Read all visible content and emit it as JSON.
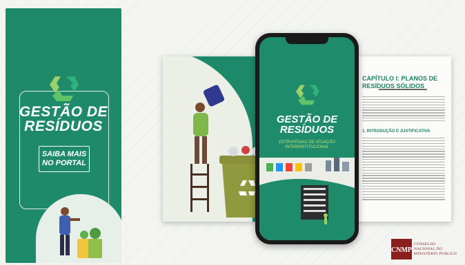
{
  "left_banner": {
    "title_line1": "GESTÃO DE",
    "title_line2": "RESÍDUOS",
    "cta_line1": "SAIBA MAIS",
    "cta_line2": "NO PORTAL"
  },
  "phone_cover": {
    "title_line1": "GESTÃO DE",
    "title_line2": "RESÍDUOS",
    "subtitle_line1": "ESTRATÉGIAS DE ATUAÇÃO",
    "subtitle_line2": "INTERINSTITUCIONAL"
  },
  "document": {
    "chapter_line1": "CAPÍTULO I: PLANOS DE",
    "chapter_line2": "RESÍDUOS SÓLIDOS",
    "section": "1. INTRODUÇÃO E JUSTIFICATIVA"
  },
  "cnmp_logo": {
    "monogram": "CNMP",
    "line1": "CONSELHO",
    "line2": "NACIONAL DO",
    "line3": "MINISTÉRIO PÚBLICO"
  },
  "colors": {
    "brand_green": "#1f8a6a",
    "accent_lime": "#c7e27a",
    "cnmp_red": "#8b1e1e"
  }
}
